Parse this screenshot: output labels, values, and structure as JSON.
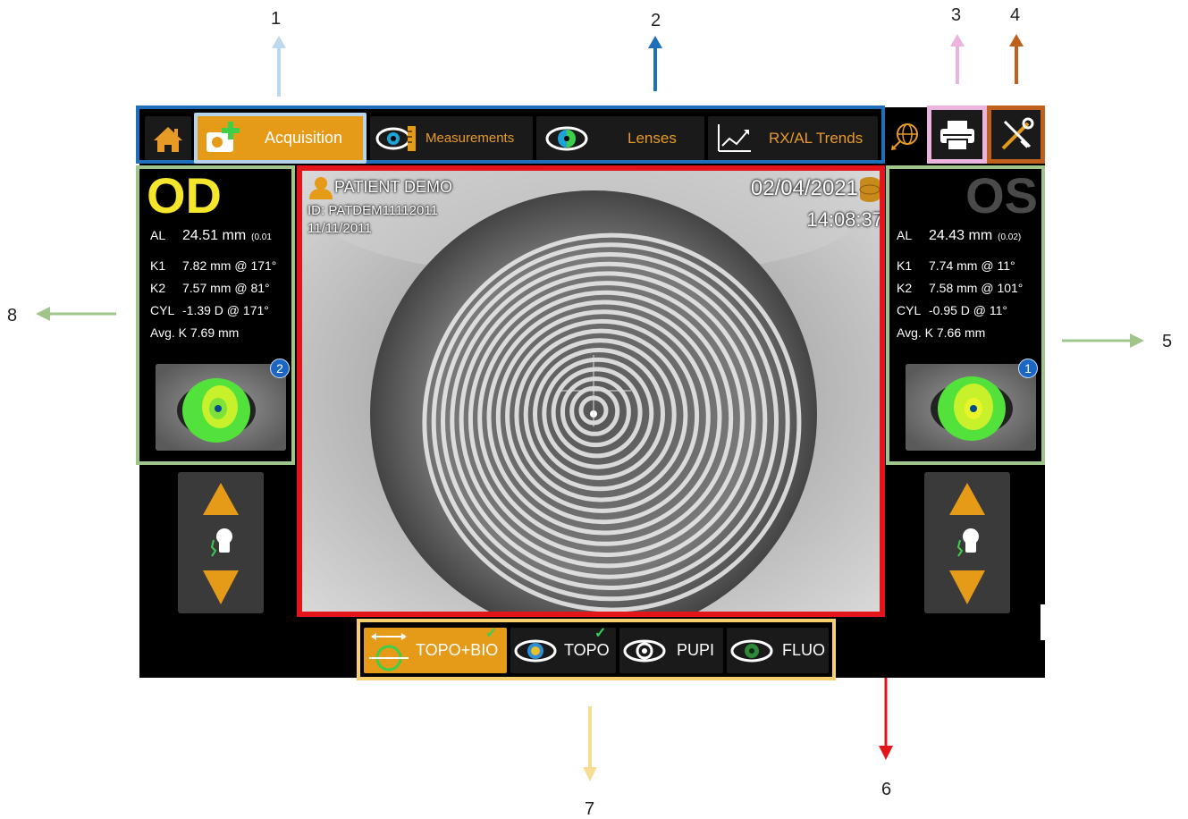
{
  "callouts": {
    "c1": "1",
    "c2": "2",
    "c3": "3",
    "c4": "4",
    "c5": "5",
    "c6": "6",
    "c7": "7",
    "c8": "8"
  },
  "colors": {
    "nav_border": "#1f6fba",
    "acquisition_highlight": "#b7d3eb",
    "print_border": "#eab4de",
    "tools_border": "#c0601f",
    "eye_panel_border": "#9fc58b",
    "main_view_border": "#e3141a",
    "mode_bar_border": "#f6cf6e",
    "accent_orange": "#e59a18",
    "od_yellow": "#f5e52b"
  },
  "nav": {
    "home_icon": "home-icon",
    "acquisition": "Acquisition",
    "measurements": "Measurements",
    "lenses": "Lenses",
    "trends": "RX/AL Trends"
  },
  "od": {
    "label": "OD",
    "al_key": "AL",
    "al_value": "24.51 mm",
    "al_sd": "(0.01",
    "k1_key": "K1",
    "k1_value": "7.82 mm @ 171°",
    "k2_key": "K2",
    "k2_value": "7.57 mm @ 81°",
    "cyl_key": "CYL",
    "cyl_value": "-1.39 D @ 171°",
    "avgk": "Avg. K 7.69 mm",
    "badge": "2"
  },
  "os": {
    "label": "OS",
    "al_key": "AL",
    "al_value": "24.43 mm",
    "al_sd": "(0.02)",
    "k1_key": "K1",
    "k1_value": "7.74 mm @ 11°",
    "k2_key": "K2",
    "k2_value": "7.58 mm @ 101°",
    "cyl_key": "CYL",
    "cyl_value": "-0.95 D @ 11°",
    "avgk": "Avg. K 7.66 mm",
    "badge": "1"
  },
  "patient": {
    "name": "PATIENT DEMO",
    "id": "ID: PATDEM11112011",
    "dob": "11/11/2011",
    "date": "02/04/2021",
    "time": "14:08:37"
  },
  "modes": {
    "topobio": "TOPO+BIO",
    "topo": "TOPO",
    "pupi": "PUPI",
    "fluo": "FLUO"
  }
}
